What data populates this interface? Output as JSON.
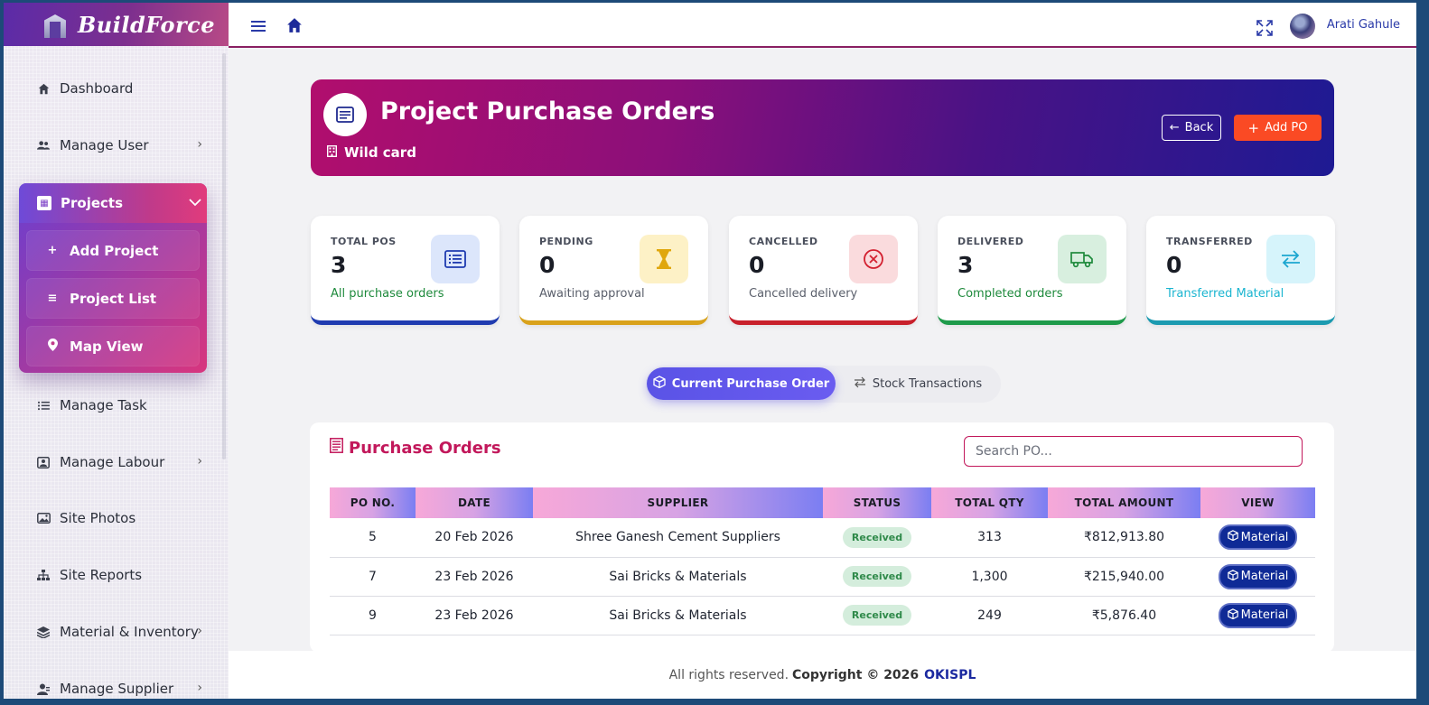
{
  "brand": {
    "name": "BuildForce"
  },
  "sidebar": {
    "items": [
      {
        "label": "Dashboard",
        "icon": "home-icon"
      },
      {
        "label": "Manage User",
        "icon": "users-icon",
        "has_children": true
      },
      {
        "label": "Manage Task",
        "icon": "list-icon"
      },
      {
        "label": "Manage Labour",
        "icon": "id-card-icon",
        "has_children": true
      },
      {
        "label": "Site Photos",
        "icon": "image-icon"
      },
      {
        "label": "Site Reports",
        "icon": "sitemap-icon"
      },
      {
        "label": "Material & Inventory",
        "icon": "layers-icon",
        "has_children": true
      },
      {
        "label": "Manage Supplier",
        "icon": "user-tie-icon",
        "has_children": true
      }
    ],
    "projects_group": {
      "label": "Projects",
      "children": [
        {
          "label": "Add Project",
          "icon": "plus-icon"
        },
        {
          "label": "Project List",
          "icon": "list-icon"
        },
        {
          "label": "Map View",
          "icon": "map-pin-icon"
        }
      ]
    }
  },
  "topbar": {
    "user_name": "Arati Gahule"
  },
  "hero": {
    "title": "Project Purchase Orders",
    "subtitle": "Wild card",
    "back_label": "Back",
    "add_label": "Add PO"
  },
  "stats": [
    {
      "label": "TOTAL POS",
      "value": "3",
      "desc": "All purchase orders",
      "color": "#1f3bb0",
      "desc_color": "#1e8a3c",
      "icon": "list-icon",
      "icon_bg": "#dce6fb",
      "icon_color": "#1f3bb0"
    },
    {
      "label": "PENDING",
      "value": "0",
      "desc": "Awaiting approval",
      "color": "#d9a21b",
      "desc_color": "#5a5f6b",
      "icon": "hourglass-icon",
      "icon_bg": "#fdf1c6",
      "icon_color": "#e0a70d"
    },
    {
      "label": "CANCELLED",
      "value": "0",
      "desc": "Cancelled delivery",
      "color": "#c8202b",
      "desc_color": "#5a5f6b",
      "icon": "cancel-circle-icon",
      "icon_bg": "#fadbdd",
      "icon_color": "#d32030"
    },
    {
      "label": "DELIVERED",
      "value": "3",
      "desc": "Completed orders",
      "color": "#1e9a4a",
      "desc_color": "#1e8a3c",
      "icon": "truck-icon",
      "icon_bg": "#d8efdf",
      "icon_color": "#1e8a3c"
    },
    {
      "label": "TRANSFERRED",
      "value": "0",
      "desc": "Transferred Material",
      "color": "#1b9ab0",
      "desc_color": "#1bb5d0",
      "icon": "transfer-icon",
      "icon_bg": "#d6f4fb",
      "icon_color": "#1ba6d0"
    }
  ],
  "tabs": {
    "current": "Current Purchase Order",
    "stock": "Stock Transactions"
  },
  "orders": {
    "title": "Purchase Orders",
    "search_placeholder": "Search PO...",
    "columns": [
      "PO NO.",
      "DATE",
      "SUPPLIER",
      "STATUS",
      "TOTAL QTY",
      "TOTAL AMOUNT",
      "VIEW"
    ],
    "rows": [
      {
        "po": "5",
        "date": "20 Feb 2026",
        "supplier": "Shree Ganesh Cement Suppliers",
        "status": "Received",
        "qty": "313",
        "amount": "₹812,913.80",
        "view": "Material"
      },
      {
        "po": "7",
        "date": "23 Feb 2026",
        "supplier": "Sai Bricks & Materials",
        "status": "Received",
        "qty": "1,300",
        "amount": "₹215,940.00",
        "view": "Material"
      },
      {
        "po": "9",
        "date": "23 Feb 2026",
        "supplier": "Sai Bricks & Materials",
        "status": "Received",
        "qty": "249",
        "amount": "₹5,876.40",
        "view": "Material"
      }
    ]
  },
  "footer": {
    "text": "All rights reserved.",
    "copyright": "Copyright © 2026",
    "company": "OKISPL"
  }
}
